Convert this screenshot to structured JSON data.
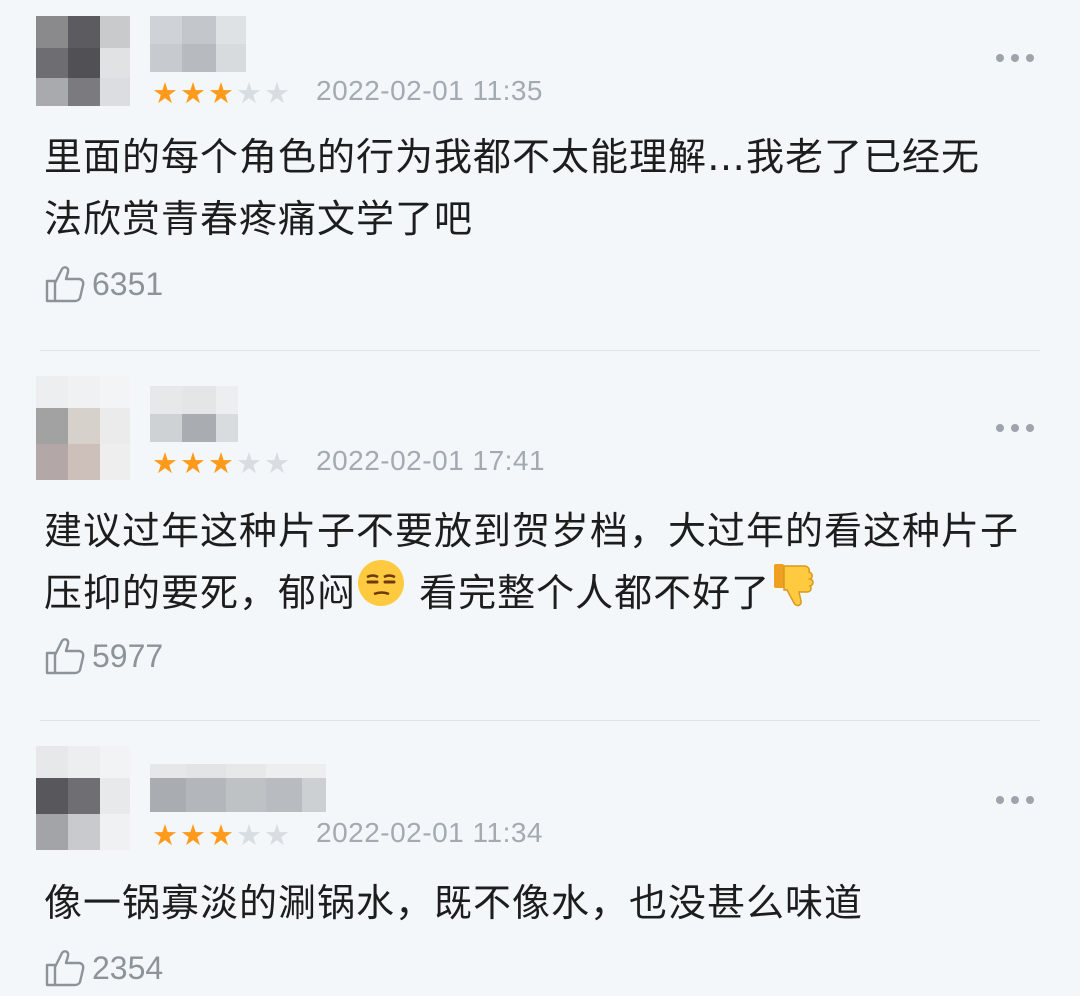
{
  "comments": [
    {
      "rating": 3,
      "rating_max": 5,
      "time": "2022-02-01 11:35",
      "text": "里面的每个角色的行为我都不太能理解…我老了已经无法欣赏青春疼痛文学了吧",
      "likes": "6351"
    },
    {
      "rating": 3,
      "rating_max": 5,
      "time": "2022-02-01 17:41",
      "text_before_emoji1": "建议过年这种片子不要放到贺岁档，大过年的看这种片子压抑的要死，郁闷",
      "text_between": " 看完整个人都不好了",
      "emoji1": "unamused-face",
      "emoji2": "thumbs-down",
      "likes": "5977"
    },
    {
      "rating": 3,
      "rating_max": 5,
      "time": "2022-02-01 11:34",
      "text": "像一锅寡淡的涮锅水，既不像水，也没甚么味道",
      "likes": "2354"
    }
  ],
  "colors": {
    "star_on": "#ff9a1a",
    "star_off": "#d8dde2",
    "muted": "#a3aab1"
  }
}
